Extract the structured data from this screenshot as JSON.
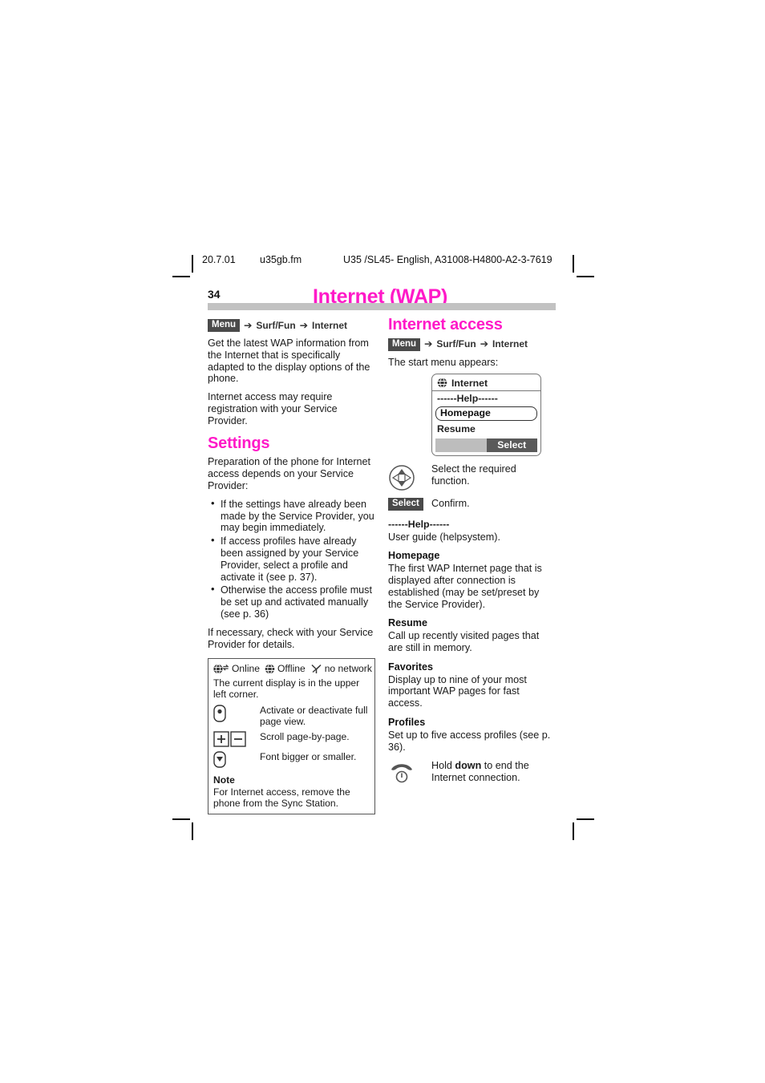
{
  "runhead": {
    "date": "20.7.01",
    "file": "u35gb.fm",
    "doc": "U35 /SL45- English, A31008-H4800-A2-3-7619"
  },
  "header": {
    "page_number": "34",
    "chapter_title": "Internet (WAP)",
    "title_color": "#ff19c8",
    "rule_color": "#c2c2c2"
  },
  "left_column": {
    "breadcrumb": {
      "key": "Menu",
      "arrow": "➔",
      "item1": "Surf/Fun",
      "item2": "Internet"
    },
    "intro_1": "Get the latest WAP information from the Internet that is specifically adapted to the display options of the phone.",
    "intro_2": "Internet access may require registration with your Service Provider.",
    "settings_heading": "Settings",
    "settings_intro": "Preparation of the phone for Internet access depends on your Service Provider:",
    "bullets": [
      "If the settings have already been made by the Service Provider, you may begin immediately.",
      "If access profiles have already been assigned by your Service Provider, select a profile and activate it (see p. 37).",
      "Otherwise the access profile must be set up and activated manually (see p. 36)"
    ],
    "closing": "If necessary, check with your Service Provider for details.",
    "note_box": {
      "status_icons": [
        {
          "icon": "globe-arrows-icon",
          "label": "Online"
        },
        {
          "icon": "globe-icon",
          "label": "Offline"
        },
        {
          "icon": "no-network-icon",
          "label": "no network"
        }
      ],
      "status_text": "The current display is in the upper left corner.",
      "key_rows": [
        {
          "icon": "full-page-view-key-icon",
          "text": "Activate or deactivate full page view."
        },
        {
          "icon": "plus-minus-keys-icon",
          "text": "Scroll page-by-page."
        },
        {
          "icon": "down-key-icon",
          "text": "Font bigger or smaller."
        }
      ],
      "note_title": "Note",
      "note_text": "For Internet access, remove the phone from the Sync Station."
    }
  },
  "right_column": {
    "heading": "Internet access",
    "breadcrumb": {
      "key": "Menu",
      "arrow": "➔",
      "item1": "Surf/Fun",
      "item2": "Internet"
    },
    "start_menu_text": "The start menu appears:",
    "phone_display": {
      "title_icon": "globe-icon",
      "title": "Internet",
      "help_row": "------Help------",
      "selected_item": "Homepage",
      "item": "Resume",
      "softkey_right": "Select"
    },
    "key_rows": [
      {
        "icon": "navigation-key-icon",
        "text": "Select the required function."
      }
    ],
    "confirm": {
      "badge": "Select",
      "text": "Confirm."
    },
    "entries": [
      {
        "heading": "------Help------",
        "dashed": true,
        "text": "User guide (helpsystem)."
      },
      {
        "heading": "Homepage",
        "dashed": false,
        "text": "The first WAP Internet page that is displayed after connection is established (may be set/preset by the Service Provider)."
      },
      {
        "heading": "Resume",
        "dashed": false,
        "text": "Call up recently visited pages that are still in memory."
      },
      {
        "heading": "Favorites",
        "dashed": false,
        "text": "Display up to nine of your most important WAP pages for fast access."
      },
      {
        "heading": "Profiles",
        "dashed": false,
        "text": "Set up to five access profiles (see p. 36)."
      }
    ],
    "end_key": {
      "icon": "end-call-key-icon",
      "text_before": "Hold ",
      "text_bold": "down",
      "text_after": " to end the Internet connection."
    }
  }
}
